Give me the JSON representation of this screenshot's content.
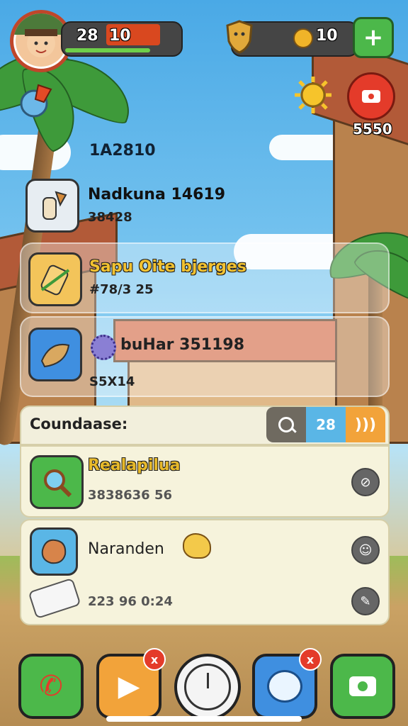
{
  "hud": {
    "level": "28",
    "health": "10",
    "coins": "10",
    "side_value": "5550",
    "floating_value": "1A2810"
  },
  "cards": [
    {
      "title": "Nadkuna 14619",
      "sub": "38428",
      "icon": "dagger-item-icon"
    },
    {
      "title": "Sapu Oite bjerges",
      "sub": "#78/3 25",
      "icon": "ticket-item-icon"
    },
    {
      "title": "buHar 351198",
      "sub": "S5X14",
      "icon": "leaf-item-icon"
    }
  ],
  "panel": {
    "header": "Coundaase:",
    "count": "28",
    "rows": [
      {
        "title": "Realapilua",
        "sub": "3838636 56",
        "icon": "magnifier-item-icon"
      },
      {
        "title": "Naranden",
        "sub": "223 96 0:24",
        "icon": "creature-item-icon"
      }
    ]
  },
  "dock": {
    "buttons": [
      "phone-icon",
      "play-icon",
      "clock-icon",
      "chat-icon",
      "camera-icon"
    ],
    "badge": "x",
    "badge2": "x"
  },
  "colors": {
    "red": "#e43b2a",
    "green": "#4cb84a",
    "orange": "#f2a33a",
    "blue": "#3f8fe0"
  }
}
